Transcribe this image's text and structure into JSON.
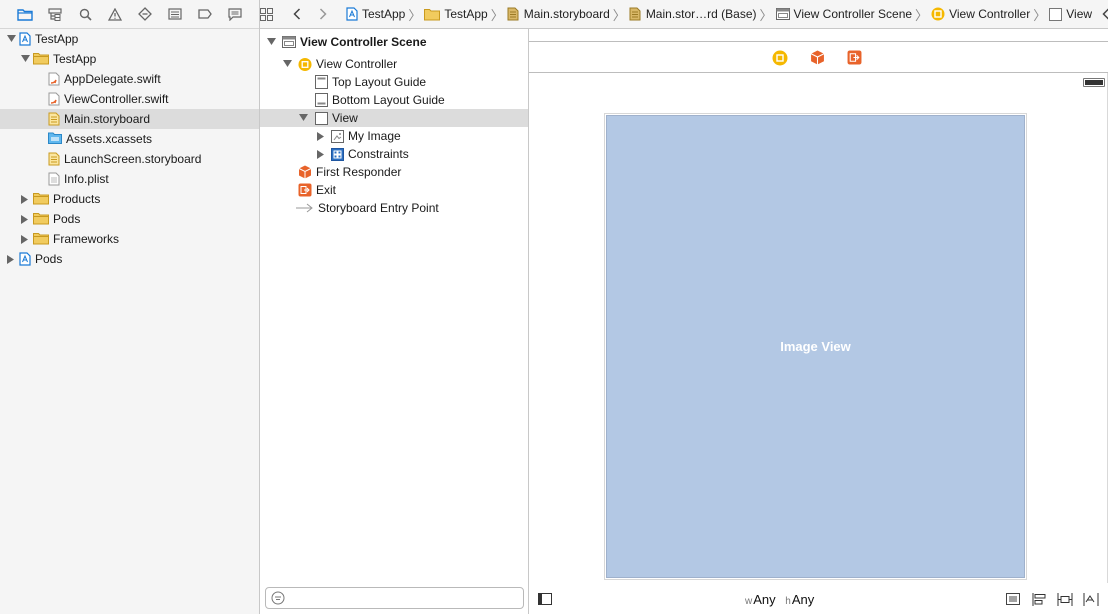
{
  "navigator": {
    "tree": [
      {
        "label": "TestApp",
        "icon": "project-icon",
        "disclosure": "open"
      },
      {
        "label": "TestApp",
        "icon": "folder-icon",
        "disclosure": "open"
      },
      {
        "label": "AppDelegate.swift",
        "icon": "swift-file-icon"
      },
      {
        "label": "ViewController.swift",
        "icon": "swift-file-icon"
      },
      {
        "label": "Main.storyboard",
        "icon": "storyboard-icon",
        "selected": true
      },
      {
        "label": "Assets.xcassets",
        "icon": "asset-catalog-icon"
      },
      {
        "label": "LaunchScreen.storyboard",
        "icon": "storyboard-icon"
      },
      {
        "label": "Info.plist",
        "icon": "plist-icon"
      },
      {
        "label": "Products",
        "icon": "folder-icon",
        "disclosure": "closed"
      },
      {
        "label": "Pods",
        "icon": "folder-icon",
        "disclosure": "closed"
      },
      {
        "label": "Frameworks",
        "icon": "folder-icon",
        "disclosure": "closed"
      },
      {
        "label": "Pods",
        "icon": "project-icon",
        "disclosure": "closed"
      }
    ]
  },
  "jumpbar": {
    "items": [
      "TestApp",
      "TestApp",
      "Main.storyboard",
      "Main.stor…rd (Base)",
      "View Controller Scene",
      "View Controller",
      "View"
    ]
  },
  "outline": {
    "rows": [
      {
        "label": "View Controller Scene",
        "icon": "scene-icon"
      },
      {
        "label": "View Controller",
        "icon": "view-controller-icon"
      },
      {
        "label": "Top Layout Guide",
        "icon": "layout-guide-icon"
      },
      {
        "label": "Bottom Layout Guide",
        "icon": "layout-guide-icon"
      },
      {
        "label": "View",
        "icon": "view-icon",
        "selected": true
      },
      {
        "label": "My Image",
        "icon": "image-view-icon"
      },
      {
        "label": "Constraints",
        "icon": "constraints-icon"
      },
      {
        "label": "First Responder",
        "icon": "first-responder-icon"
      },
      {
        "label": "Exit",
        "icon": "exit-icon"
      },
      {
        "label": "Storyboard Entry Point",
        "icon": "entry-arrow-icon"
      }
    ]
  },
  "canvas": {
    "image_view_label": "Image View",
    "size_class": {
      "w_prefix": "w",
      "w_value": "Any",
      "h_prefix": "h",
      "h_value": "Any"
    }
  },
  "colors": {
    "selection": "#dcdcdc",
    "image_view_fill": "#b3c8e4",
    "accent_blue": "#1a7ad6",
    "vc_yellow": "#f5b800",
    "orange": "#e8632a",
    "warning": "#f2c200"
  }
}
